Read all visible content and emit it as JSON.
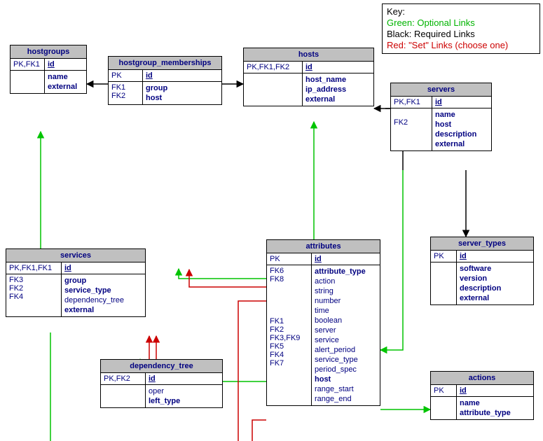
{
  "legend": {
    "title": "Key:",
    "opt": "Green: Optional Links",
    "req": "Black: Required Links",
    "set": "Red: \"Set\" Links (choose one)"
  },
  "hostgroups": {
    "title": "hostgroups",
    "k1": "PK,FK1",
    "id": "id",
    "a1": "name",
    "a2": "external"
  },
  "hgm": {
    "title": "hostgroup_memberships",
    "k1": "PK",
    "id": "id",
    "k2": "FK1",
    "a2": "group",
    "k3": "FK2",
    "a3": "host"
  },
  "hosts": {
    "title": "hosts",
    "k1": "PK,FK1,FK2",
    "id": "id",
    "a1": "host_name",
    "a2": "ip_address",
    "a3": "external"
  },
  "servers": {
    "title": "servers",
    "k1": "PK,FK1",
    "id": "id",
    "k2": "FK2",
    "a1": "name",
    "a2": "host",
    "a3": "description",
    "a4": "external"
  },
  "server_types": {
    "title": "server_types",
    "k1": "PK",
    "id": "id",
    "a1": "software",
    "a2": "version",
    "a3": "description",
    "a4": "external"
  },
  "services": {
    "title": "services",
    "k1": "PK,FK1,FK1",
    "id": "id",
    "k2": "FK3",
    "k3": "FK2",
    "k4": "FK4",
    "a1": "group",
    "a2": "service_type",
    "a3": "dependency_tree",
    "a4": "external"
  },
  "dep": {
    "title": "dependency_tree",
    "k1": "PK,FK2",
    "id": "id",
    "a1": "oper",
    "a2": "left_type"
  },
  "attributes": {
    "title": "attributes",
    "k1": "PK",
    "id": "id",
    "k2": "FK6",
    "k3": "FK8",
    "k4": "FK1",
    "k5": "FK2",
    "k6": "FK3,FK9",
    "k7": "FK5",
    "k8": "FK4",
    "k9": "FK7",
    "a1": "attribute_type",
    "a2": "action",
    "a3": "string",
    "a4": "number",
    "a5": "time",
    "a6": "boolean",
    "a7": "server",
    "a8": "service",
    "a9": "alert_period",
    "a10": "service_type",
    "a11": "period_spec",
    "a12": "host",
    "a13": "range_start",
    "a14": "range_end"
  },
  "actions": {
    "title": "actions",
    "k1": "PK",
    "id": "id",
    "a1": "name",
    "a2": "attribute_type"
  }
}
